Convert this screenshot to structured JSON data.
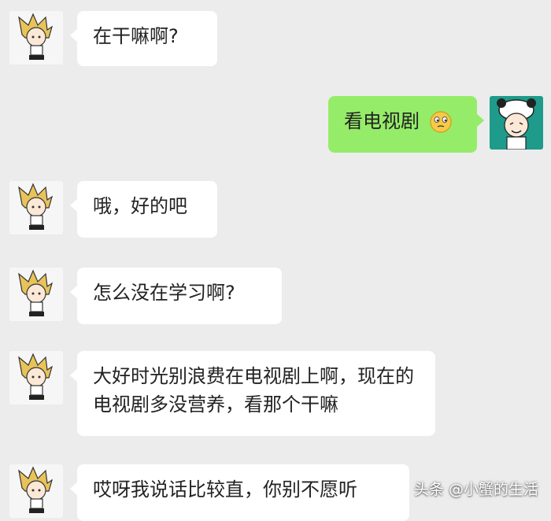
{
  "chat": {
    "messages": [
      {
        "side": "left",
        "text": "在干嘛啊?"
      },
      {
        "side": "right",
        "text": "看电视剧",
        "emoji": "smirk-emoji-icon"
      },
      {
        "side": "left",
        "text": "哦，好的吧"
      },
      {
        "side": "left",
        "text": "怎么没在学习啊?"
      },
      {
        "side": "left",
        "text": "大好时光别浪费在电视剧上啊，现在的电视剧多没营养，看那个干嘛"
      },
      {
        "side": "left",
        "text": "哎呀我说话比较直，你别不愿听"
      }
    ]
  },
  "avatars": {
    "contact": "blonde-cartoon-boy-avatar",
    "self": "panda-hat-cartoon-avatar"
  },
  "colors": {
    "background": "#ececec",
    "bubble_left": "#ffffff",
    "bubble_right": "#95ec69"
  },
  "watermark": {
    "text": "头条 @小蟹的生活"
  }
}
